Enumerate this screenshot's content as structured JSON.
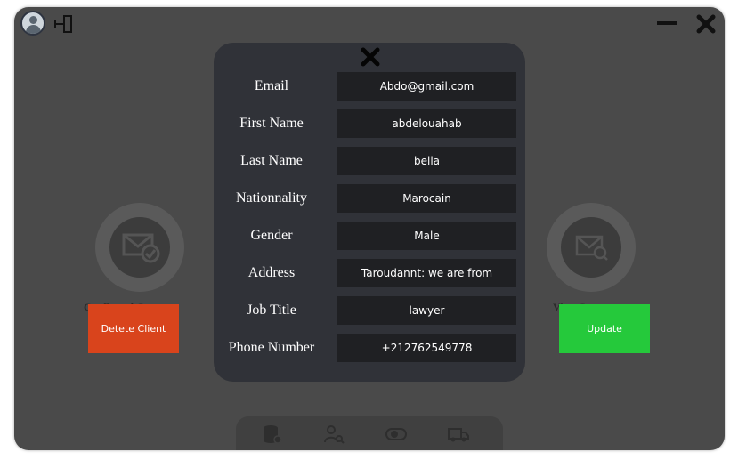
{
  "buttons": {
    "delete_label": "Detete Client",
    "update_label": "Update"
  },
  "side_labels": {
    "left": "Confirmed Cryster",
    "right": "View Cryster"
  },
  "form": {
    "fields": [
      {
        "label": "Email",
        "value": "Abdo@gmail.com"
      },
      {
        "label": "First Name",
        "value": "abdelouahab"
      },
      {
        "label": "Last Name",
        "value": "bella"
      },
      {
        "label": "Nationnality",
        "value": "Marocain"
      },
      {
        "label": "Gender",
        "value": "Male"
      },
      {
        "label": "Address",
        "value": "Taroudannt: we are from"
      },
      {
        "label": "Job Title",
        "value": "lawyer"
      },
      {
        "label": "Phone Number",
        "value": "+212762549778"
      }
    ]
  },
  "icons": {
    "avatar": "user-avatar-icon",
    "logout": "logout-icon",
    "minimize": "minimize-icon",
    "close_window": "close-icon",
    "modal_close": "close-icon",
    "left_circle": "mail-check-icon",
    "right_circle": "mail-view-icon",
    "bottom_bar": [
      "database-icon",
      "user-search-icon",
      "toggle-icon",
      "truck-icon"
    ]
  },
  "colors": {
    "delete": "#d9441c",
    "update": "#25c93b",
    "modal_bg": "#303238",
    "field_bg": "#1f2023"
  }
}
